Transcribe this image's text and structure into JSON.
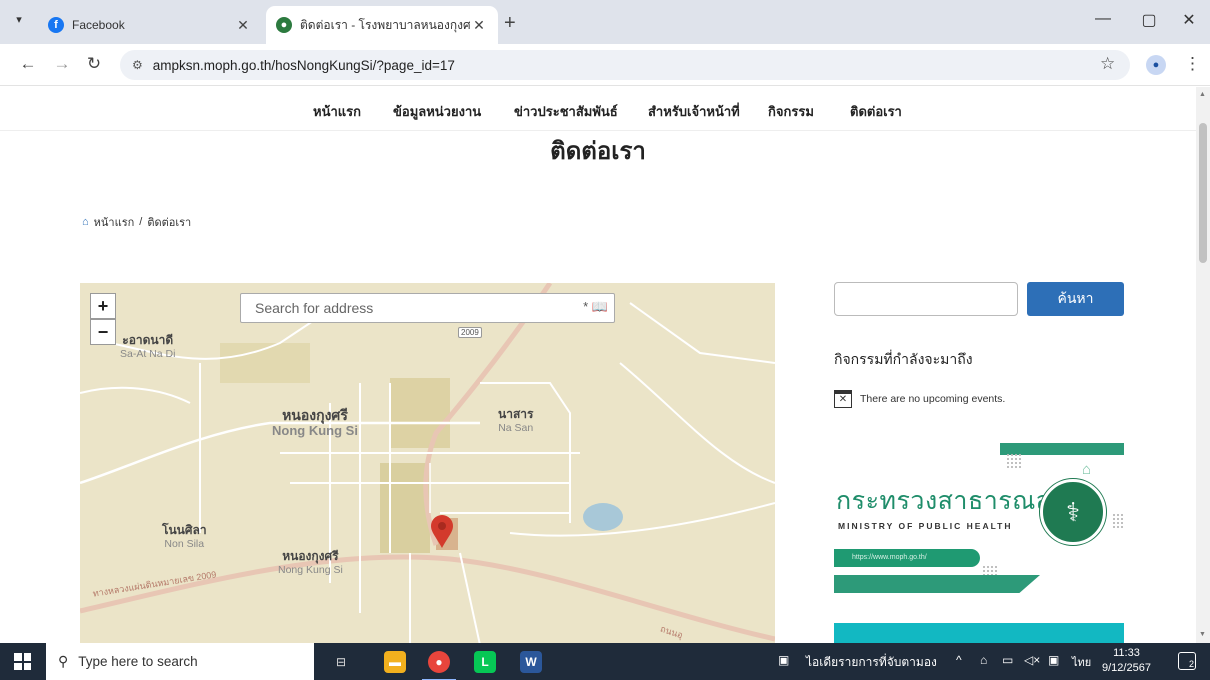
{
  "browser": {
    "tabs": [
      {
        "title": "Facebook",
        "icon": "facebook-icon"
      },
      {
        "title": "ติดต่อเรา - โรงพยาบาลหนองกุงศรี",
        "icon": "site-favicon"
      }
    ],
    "url": "ampksn.moph.go.th/hosNongKungSi/?page_id=17"
  },
  "site": {
    "nav": [
      "หน้าแรก",
      "ข้อมูลหน่วยงาน",
      "ข่าวประชาสัมพันธ์",
      "สำหรับเจ้าหน้าที่",
      "กิจกรรม",
      "ติดต่อเรา"
    ],
    "page_title": "ติดต่อเรา",
    "breadcrumb": {
      "home": "หน้าแรก",
      "separator": "/",
      "current": "ติดต่อเรา"
    }
  },
  "map": {
    "zoom_in": "+",
    "zoom_out": "−",
    "search_placeholder": "Search for address",
    "labels": [
      {
        "th": "ะอาดนาดี",
        "en": "Sa-At Na Di"
      },
      {
        "th": "หนองกุงศรี",
        "en": "Nong Kung Si"
      },
      {
        "th": "นาสาร",
        "en": "Na San"
      },
      {
        "th": "โนนศิลา",
        "en": "Non Sila"
      },
      {
        "th": "หนองกุงศรี",
        "en": "Nong Kung Si"
      }
    ],
    "route_number": "2009",
    "road_label": "ทางหลวงแผ่นดินหมายเลข 2009",
    "road_label_2": "ถนนอุ",
    "marker_color": "#d33a2c"
  },
  "sidebar": {
    "search_button": "ค้นหา",
    "events_title": "กิจกรรมที่กำลังจะมาถึง",
    "no_events": "There are no upcoming events.",
    "banner": {
      "thai": "กระทรวงสาธารณสุข",
      "english": "MINISTRY OF PUBLIC HEALTH",
      "url": "https://www.moph.go.th/",
      "color": "#1f8d6a"
    }
  },
  "taskbar": {
    "search_placeholder": "Type here to search",
    "apps": [
      "task-view-icon",
      "file-explorer-icon",
      "chrome-icon",
      "line-icon",
      "word-icon"
    ],
    "tray_news": "ไอเดียรายการที่จับตามอง",
    "language": "ไทย",
    "time": "11:33",
    "date": "9/12/2567",
    "notification_count": "2"
  }
}
